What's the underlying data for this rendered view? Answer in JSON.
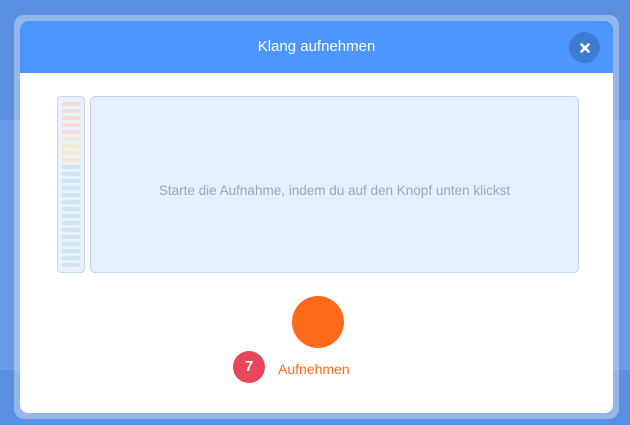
{
  "modal": {
    "title": "Klang aufnehmen",
    "close_icon": "close-icon"
  },
  "recorder": {
    "hint": "Starte die Aufnahme, indem du auf den Knopf unten klickst",
    "record_label": "Aufnehmen",
    "step_badge": "7",
    "level": 0
  },
  "colors": {
    "header": "#4c97ff",
    "record": "#ff6b1a",
    "badge": "#e8465b",
    "meter_low": "#cfe6ee",
    "meter_mid": "#f1ead0",
    "meter_high": "#f4ddd8"
  }
}
